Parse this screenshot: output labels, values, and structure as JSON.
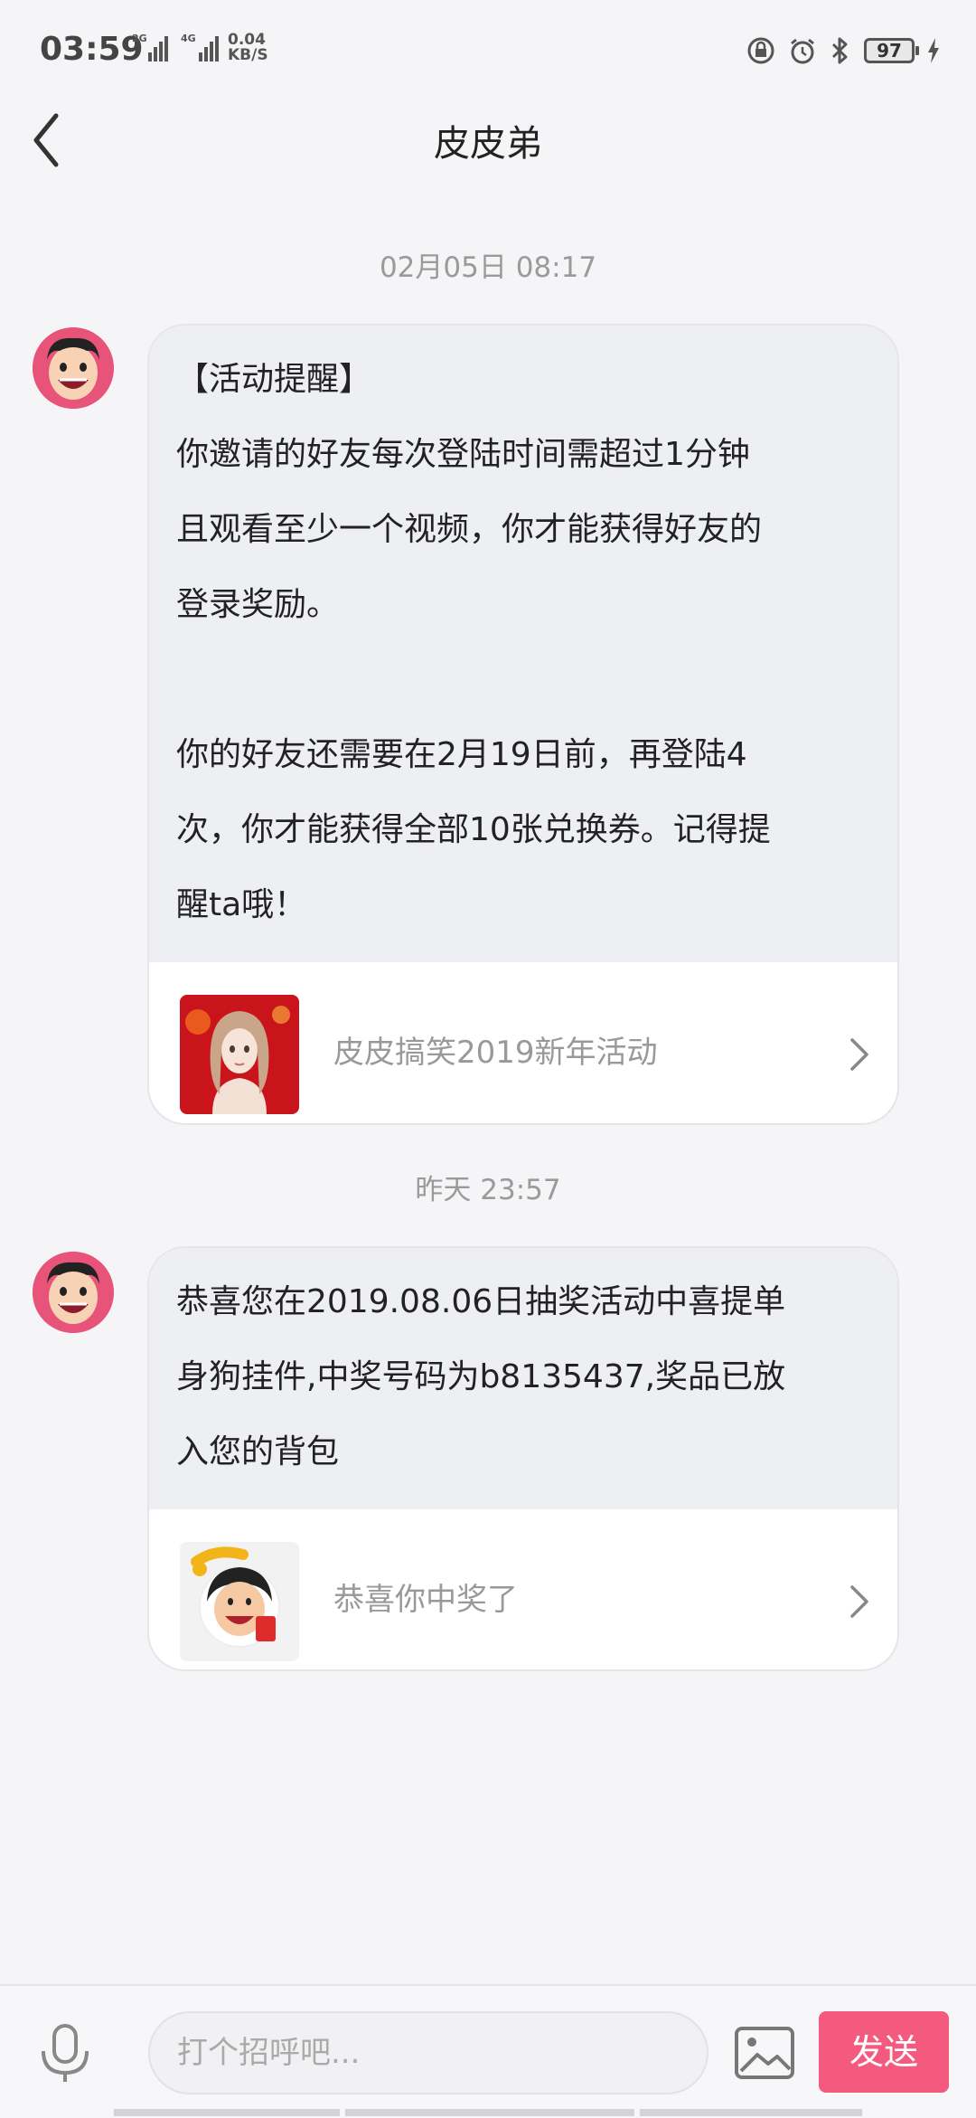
{
  "status_bar": {
    "time": "03:59",
    "net1": "2G",
    "net2": "4G",
    "speed_value": "0.04",
    "speed_unit": "KB/S",
    "battery": "97"
  },
  "nav": {
    "title": "皮皮弟"
  },
  "messages": [
    {
      "timestamp": "02月05日 08:17",
      "lines": [
        "【活动提醒】",
        "你邀请的好友每次登陆时间需超过1分钟",
        "且观看至少一个视频，你才能获得好友的",
        "登录奖励。",
        "你的好友还需要在2月19日前，再登陆4",
        "次，你才能获得全部10张兑换券。记得提",
        "醒ta哦！"
      ],
      "link_text": "皮皮搞笑2019新年活动",
      "thumb_icon": "doll-promo-image"
    },
    {
      "timestamp": "昨天 23:57",
      "lines": [
        "恭喜您在2019.08.06日抽奖活动中喜提单",
        "身狗挂件,中奖号码为b8135437,奖品已放",
        "入您的背包"
      ],
      "link_text": "恭喜你中奖了",
      "thumb_icon": "lottery-cartoon-image"
    }
  ],
  "input": {
    "placeholder": "打个招呼吧...",
    "send_label": "发送"
  },
  "colors": {
    "accent": "#f4597e",
    "bubble": "#eeeff2",
    "avatar_bg": "#e8537a"
  }
}
